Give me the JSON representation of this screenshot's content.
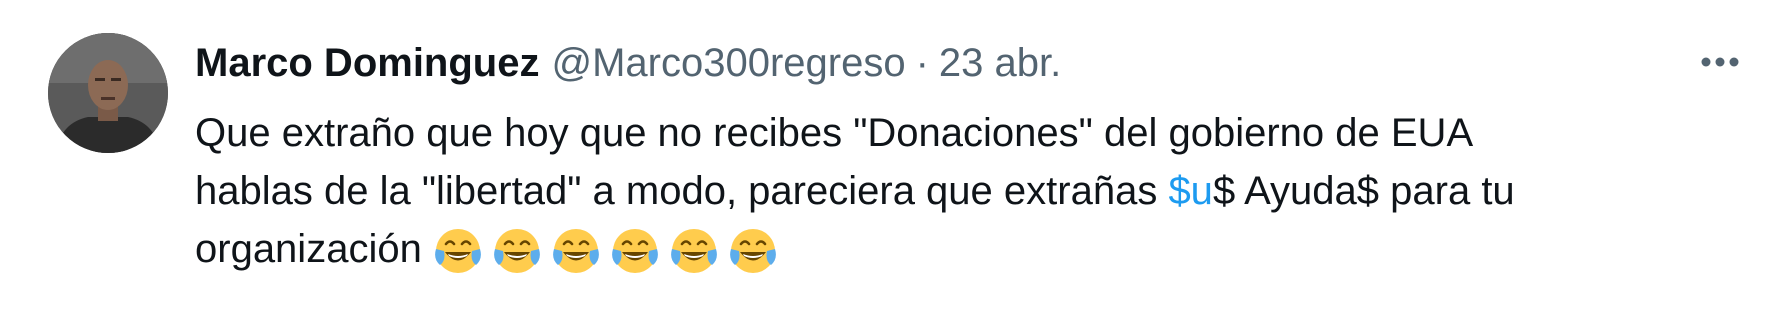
{
  "tweet": {
    "author_name": "Marco Dominguez",
    "handle": "@Marco300regreso",
    "separator": "·",
    "timestamp": "23 abr.",
    "more_icon": "more-horizontal-icon",
    "line1": "Que extraño que hoy que no recibes \"Donaciones\" del gobierno de EUA",
    "line2_before": "hablas de la \"libertad\" a modo, pareciera que extrañas ",
    "cashtag": "$u",
    "line2_after": "$ Ayuda$ para tu",
    "line3": "organización",
    "emoji_name": "face-with-tears-of-joy",
    "emoji_count": 6
  },
  "colors": {
    "text": "#0f1419",
    "secondary": "#536471",
    "link": "#1d9bf0"
  }
}
